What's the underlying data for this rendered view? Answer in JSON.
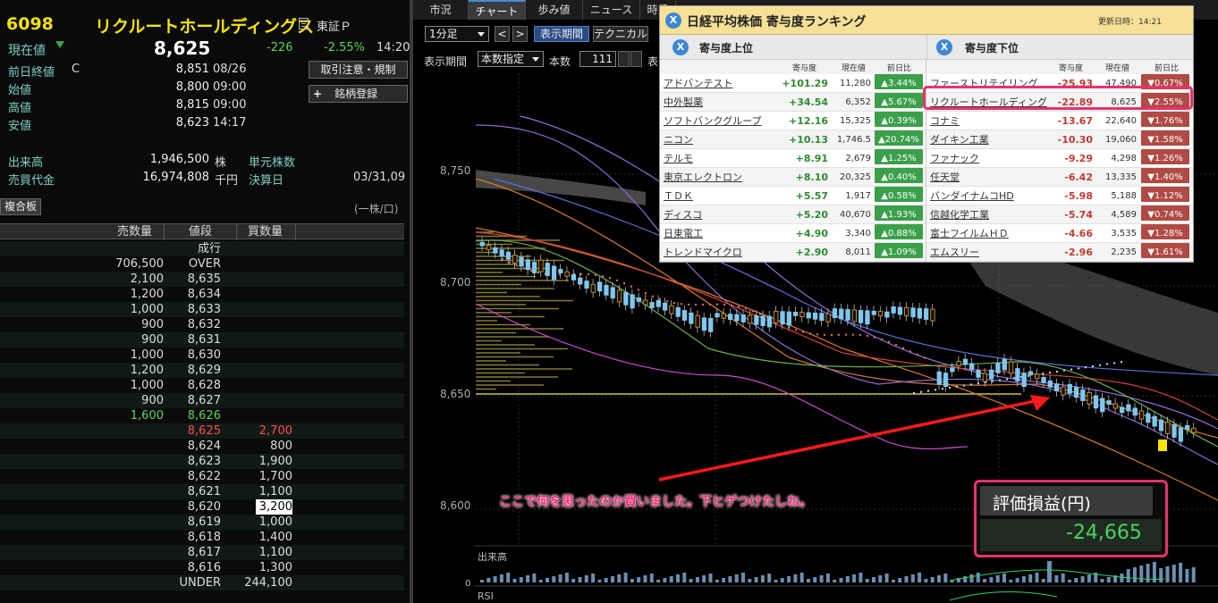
{
  "stock": {
    "code": "6098",
    "name": "リクルートホールディングス",
    "market_icon": "document-icon",
    "market": "東証Ｐ",
    "current_label": "現在値",
    "current_value": "8,625",
    "change": "-226",
    "change_pct": "-2.55%",
    "current_time": "14:20",
    "prev_close_label": "前日終値",
    "prev_close_flag": "C",
    "prev_close_value": "8,851",
    "prev_close_date": "08/26",
    "open_label": "始値",
    "open_value": "8,800",
    "open_time": "09:00",
    "high_label": "高値",
    "high_value": "8,815",
    "high_time": "09:00",
    "low_label": "安値",
    "low_value": "8,623",
    "low_time": "14:17",
    "volume_label": "出来高",
    "volume_value": "1,946,500",
    "volume_unit": "株",
    "unit_label": "単元株数",
    "turnover_label": "売買代金",
    "turnover_value": "16,974,808",
    "turnover_unit": "千円",
    "settle_label": "決算日",
    "settle_value": "03/31,09",
    "notice_button": "取引注意・規制",
    "register_button": "銘柄登録",
    "register_plus": "+"
  },
  "orderbook": {
    "title": "複合板",
    "unit_note": "(一株/口)",
    "headers": [
      "売数量",
      "値段",
      "買数量"
    ],
    "rows": [
      {
        "sell": "",
        "price": "成行",
        "buy": ""
      },
      {
        "sell": "706,500",
        "price": "OVER",
        "buy": ""
      },
      {
        "sell": "2,100",
        "price": "8,635",
        "buy": ""
      },
      {
        "sell": "1,200",
        "price": "8,634",
        "buy": ""
      },
      {
        "sell": "1,000",
        "price": "8,633",
        "buy": ""
      },
      {
        "sell": "900",
        "price": "8,632",
        "buy": ""
      },
      {
        "sell": "900",
        "price": "8,631",
        "buy": ""
      },
      {
        "sell": "1,000",
        "price": "8,630",
        "buy": ""
      },
      {
        "sell": "1,200",
        "price": "8,629",
        "buy": ""
      },
      {
        "sell": "1,000",
        "price": "8,628",
        "buy": ""
      },
      {
        "sell": "900",
        "price": "8,627",
        "buy": ""
      },
      {
        "sell": "1,600",
        "price": "8,626",
        "buy": ""
      },
      {
        "sell": "",
        "price": "8,625",
        "buy": "2,700"
      },
      {
        "sell": "",
        "price": "8,624",
        "buy": "800"
      },
      {
        "sell": "",
        "price": "8,623",
        "buy": "1,900"
      },
      {
        "sell": "",
        "price": "8,622",
        "buy": "1,700"
      },
      {
        "sell": "",
        "price": "8,621",
        "buy": "1,100"
      },
      {
        "sell": "",
        "price": "8,620",
        "buy": "3,200"
      },
      {
        "sell": "",
        "price": "8,619",
        "buy": "1,000"
      },
      {
        "sell": "",
        "price": "8,618",
        "buy": "1,400"
      },
      {
        "sell": "",
        "price": "8,617",
        "buy": "1,100"
      },
      {
        "sell": "",
        "price": "8,616",
        "buy": "1,300"
      },
      {
        "sell": "",
        "price": "UNDER",
        "buy": "244,100"
      }
    ]
  },
  "tabs": [
    "市況",
    "チャート",
    "歩み値",
    "ニュース",
    "時系"
  ],
  "toolbar": {
    "interval": "1分足",
    "prev": "<",
    "next": ">",
    "period_button": "表示期間",
    "tech_button": "テクニカル",
    "period_label": "表示期間",
    "period_select": "本数指定",
    "count_label": "本数",
    "count_value": "111",
    "trailing_label": "表"
  },
  "chart": {
    "price_ticks": [
      "8,750",
      "8,700",
      "8,650",
      "8,600"
    ],
    "volume_label": "出来高",
    "volume_zero": "0",
    "rsi_label": "RSI",
    "annotation": "ここで何を思ったのか買いました。下ヒゲつけたしね。",
    "pnl_label": "評価損益(円)",
    "pnl_value": "-24,665"
  },
  "ranking": {
    "title": "日経平均株価 寄与度ランキング",
    "updated": "更新日時：14:21",
    "top_title": "寄与度上位",
    "bottom_title": "寄与度下位",
    "col_headers": [
      "寄与度",
      "現在値",
      "前日比"
    ],
    "top": [
      {
        "name": "アドバンテスト",
        "contrib": "+101.29",
        "price": "11,280",
        "chg": "▲3.44%"
      },
      {
        "name": "中外製薬",
        "contrib": "+34.54",
        "price": "6,352",
        "chg": "▲5.67%"
      },
      {
        "name": "ソフトバンクグループ",
        "contrib": "+12.16",
        "price": "15,325",
        "chg": "▲0.39%"
      },
      {
        "name": "ニコン",
        "contrib": "+10.13",
        "price": "1,746.5",
        "chg": "▲20.74%"
      },
      {
        "name": "テルモ",
        "contrib": "+8.91",
        "price": "2,679",
        "chg": "▲1.25%"
      },
      {
        "name": "東京エレクトロン",
        "contrib": "+8.10",
        "price": "20,325",
        "chg": "▲0.40%"
      },
      {
        "name": "ＴＤＫ",
        "contrib": "+5.57",
        "price": "1,917",
        "chg": "▲0.58%"
      },
      {
        "name": "ディスコ",
        "contrib": "+5.20",
        "price": "40,670",
        "chg": "▲1.93%"
      },
      {
        "name": "日東電工",
        "contrib": "+4.90",
        "price": "3,340",
        "chg": "▲0.88%"
      },
      {
        "name": "トレンドマイクロ",
        "contrib": "+2.90",
        "price": "8,011",
        "chg": "▲1.09%"
      }
    ],
    "bottom": [
      {
        "name": "ファーストリテイリング",
        "contrib": "-25.93",
        "price": "47,490",
        "chg": "▼0.67%"
      },
      {
        "name": "リクルートホールディング",
        "contrib": "-22.89",
        "price": "8,625",
        "chg": "▼2.55%"
      },
      {
        "name": "コナミ",
        "contrib": "-13.67",
        "price": "22,640",
        "chg": "▼1.76%"
      },
      {
        "name": "ダイキン工業",
        "contrib": "-10.30",
        "price": "19,060",
        "chg": "▼1.58%"
      },
      {
        "name": "ファナック",
        "contrib": "-9.29",
        "price": "4,298",
        "chg": "▼1.26%"
      },
      {
        "name": "任天堂",
        "contrib": "-6.42",
        "price": "13,335",
        "chg": "▼1.40%"
      },
      {
        "name": "バンダイナムコHD",
        "contrib": "-5.98",
        "price": "5,188",
        "chg": "▼1.12%"
      },
      {
        "name": "信越化学工業",
        "contrib": "-5.74",
        "price": "4,589",
        "chg": "▼0.74%"
      },
      {
        "name": "富士フイルムＨＤ",
        "contrib": "-4.66",
        "price": "3,535",
        "chg": "▼1.28%"
      },
      {
        "name": "エムスリー",
        "contrib": "-2.96",
        "price": "2,235",
        "chg": "▼1.61%"
      }
    ]
  },
  "colors": {
    "accent_yellow": "#f5e300",
    "up_green": "#3aa04a",
    "down_red": "#b04a44",
    "highlight_pink": "#e8336c"
  }
}
